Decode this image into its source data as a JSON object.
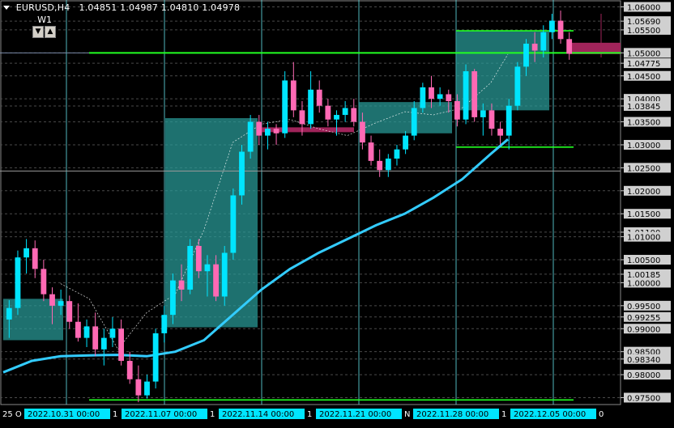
{
  "header": {
    "symbol": "EURUSD,H4",
    "ohlc": "1.04851 1.04987 1.04810 1.04978"
  },
  "overlay_badge": {
    "label": "W1",
    "down_arrow": "▼",
    "up_arrow": "▲"
  },
  "colors": {
    "background": "#000000",
    "grid": "#4a4a4a",
    "bull_candle": "#00e5ff",
    "bear_candle": "#ff69b4",
    "box_fill": "#2a9d9a",
    "green_line": "#22ff22",
    "ma_thick": "#33ccff",
    "ma_thin": "#ffffff",
    "price_label_bg": "#d0d0d0",
    "date_label_bg": "#00e5ff",
    "resistance_bar": "#a0245a"
  },
  "price_axis": {
    "labels": [
      "1.06000",
      "1.05690",
      "1.05500",
      "1.05000",
      "1.04775",
      "1.04500",
      "1.04000",
      "1.03845",
      "1.03500",
      "1.03000",
      "1.02500",
      "1.02000",
      "1.01500",
      "1.01100",
      "1.01000",
      "1.00500",
      "1.00185",
      "1.00000",
      "0.99500",
      "0.99255",
      "0.99000",
      "0.98500",
      "0.98340",
      "0.98000",
      "0.97500"
    ]
  },
  "time_axis": {
    "left_edge_label": "25 O",
    "labels": [
      {
        "text": "2022.10.31 00:00",
        "next": "1"
      },
      {
        "text": "2022.11.07 00:00",
        "next": "1"
      },
      {
        "text": "2022.11.14 00:00",
        "next": "1"
      },
      {
        "text": "2022.11.21 00:00",
        "next": "N"
      },
      {
        "text": "2022.11.28 00:00",
        "next": "1"
      },
      {
        "text": "2022.12.05 00:00",
        "next": "0"
      }
    ]
  },
  "chart_data": {
    "type": "candlestick",
    "symbol": "EURUSD",
    "timeframe": "H4",
    "title": "EURUSD,H4",
    "ohlc_last": {
      "open": 1.04851,
      "high": 1.04987,
      "low": 1.0481,
      "close": 1.04978
    },
    "ylim": [
      0.9735,
      1.0615
    ],
    "grid": true,
    "price_ticks": [
      1.06,
      1.0569,
      1.055,
      1.05,
      1.04775,
      1.045,
      1.04,
      1.03845,
      1.035,
      1.03,
      1.025,
      1.02,
      1.015,
      1.011,
      1.01,
      1.005,
      1.00185,
      1.0,
      0.995,
      0.99255,
      0.99,
      0.985,
      0.9834,
      0.98,
      0.975
    ],
    "week_separators": [
      "2022.10.31 00:00",
      "2022.11.07 00:00",
      "2022.11.14 00:00",
      "2022.11.21 00:00",
      "2022.11.28 00:00",
      "2022.12.05 00:00"
    ],
    "horizontal_levels": [
      {
        "price": 1.05,
        "color": "green"
      },
      {
        "price": 0.9745,
        "color": "green"
      },
      {
        "price": 1.0548,
        "color": "green"
      },
      {
        "price": 1.0295,
        "color": "green"
      }
    ],
    "weekly_boxes": [
      {
        "start": "2022.10.24 00:00",
        "end": "2022.10.31 00:00",
        "high": 0.9965,
        "low": 0.9875
      },
      {
        "start": "2022.11.07 00:00",
        "end": "2022.11.14 00:00",
        "high": 1.0358,
        "low": 0.9903
      },
      {
        "start": "2022.11.21 00:00",
        "end": "2022.11.28 00:00",
        "high": 1.0393,
        "low": 1.0325
      },
      {
        "start": "2022.11.28 00:00",
        "end": "2022.12.05 00:00",
        "high": 1.0548,
        "low": 1.0375
      }
    ],
    "moving_averages": [
      {
        "style": "thick",
        "points": [
          [
            0.0,
            0.9805
          ],
          [
            0.05,
            0.983
          ],
          [
            0.1,
            0.984
          ],
          [
            0.15,
            0.9842
          ],
          [
            0.2,
            0.9843
          ],
          [
            0.25,
            0.984
          ],
          [
            0.3,
            0.985
          ],
          [
            0.35,
            0.9875
          ],
          [
            0.4,
            0.993
          ],
          [
            0.45,
            0.9985
          ],
          [
            0.5,
            1.003
          ],
          [
            0.55,
            1.0065
          ],
          [
            0.6,
            1.0095
          ],
          [
            0.65,
            1.0125
          ],
          [
            0.7,
            1.015
          ],
          [
            0.75,
            1.0185
          ],
          [
            0.8,
            1.0225
          ],
          [
            0.85,
            1.028
          ],
          [
            0.88,
            1.0312
          ]
        ]
      },
      {
        "style": "thin",
        "points": [
          [
            0.1,
            0.9998
          ],
          [
            0.15,
            0.9965
          ],
          [
            0.2,
            0.9855
          ],
          [
            0.25,
            0.9935
          ],
          [
            0.3,
            0.9975
          ],
          [
            0.35,
            1.0115
          ],
          [
            0.4,
            1.0305
          ],
          [
            0.45,
            1.0345
          ],
          [
            0.5,
            1.0355
          ],
          [
            0.55,
            1.0335
          ],
          [
            0.6,
            1.032
          ],
          [
            0.65,
            1.0348
          ],
          [
            0.7,
            1.0372
          ],
          [
            0.75,
            1.0365
          ],
          [
            0.8,
            1.038
          ],
          [
            0.85,
            1.0435
          ],
          [
            0.88,
            1.0497
          ]
        ]
      }
    ],
    "candles": [
      {
        "o": 0.992,
        "h": 0.9962,
        "l": 0.988,
        "c": 0.9945
      },
      {
        "o": 0.9945,
        "h": 1.007,
        "l": 0.993,
        "c": 1.0055
      },
      {
        "o": 1.0055,
        "h": 1.0095,
        "l": 1.002,
        "c": 1.0075
      },
      {
        "o": 1.0075,
        "h": 1.0092,
        "l": 1.001,
        "c": 1.003
      },
      {
        "o": 1.003,
        "h": 1.005,
        "l": 0.996,
        "c": 0.9975
      },
      {
        "o": 0.9975,
        "h": 0.999,
        "l": 0.991,
        "c": 0.995
      },
      {
        "o": 0.995,
        "h": 0.9985,
        "l": 0.993,
        "c": 0.996
      },
      {
        "o": 0.996,
        "h": 0.9972,
        "l": 0.99,
        "c": 0.9915
      },
      {
        "o": 0.9915,
        "h": 0.9955,
        "l": 0.9872,
        "c": 0.988
      },
      {
        "o": 0.988,
        "h": 0.992,
        "l": 0.986,
        "c": 0.9905
      },
      {
        "o": 0.9905,
        "h": 0.9935,
        "l": 0.984,
        "c": 0.9855
      },
      {
        "o": 0.9855,
        "h": 0.99,
        "l": 0.982,
        "c": 0.988
      },
      {
        "o": 0.988,
        "h": 0.9925,
        "l": 0.986,
        "c": 0.99
      },
      {
        "o": 0.99,
        "h": 0.992,
        "l": 0.982,
        "c": 0.983
      },
      {
        "o": 0.983,
        "h": 0.985,
        "l": 0.978,
        "c": 0.979
      },
      {
        "o": 0.979,
        "h": 0.982,
        "l": 0.974,
        "c": 0.9755
      },
      {
        "o": 0.9755,
        "h": 0.98,
        "l": 0.9748,
        "c": 0.9785
      },
      {
        "o": 0.9785,
        "h": 0.99,
        "l": 0.977,
        "c": 0.989
      },
      {
        "o": 0.989,
        "h": 0.995,
        "l": 0.987,
        "c": 0.993
      },
      {
        "o": 0.993,
        "h": 1.002,
        "l": 0.991,
        "c": 1.0005
      },
      {
        "o": 1.0005,
        "h": 1.004,
        "l": 0.996,
        "c": 0.9985
      },
      {
        "o": 0.9985,
        "h": 1.0095,
        "l": 0.9975,
        "c": 1.008
      },
      {
        "o": 1.008,
        "h": 1.0095,
        "l": 1.001,
        "c": 1.0025
      },
      {
        "o": 1.0025,
        "h": 1.006,
        "l": 0.997,
        "c": 1.004
      },
      {
        "o": 1.004,
        "h": 1.006,
        "l": 0.996,
        "c": 0.997
      },
      {
        "o": 0.997,
        "h": 1.008,
        "l": 0.995,
        "c": 1.0065
      },
      {
        "o": 1.0065,
        "h": 1.0205,
        "l": 1.005,
        "c": 1.019
      },
      {
        "o": 1.019,
        "h": 1.03,
        "l": 1.017,
        "c": 1.0285
      },
      {
        "o": 1.0285,
        "h": 1.0365,
        "l": 1.027,
        "c": 1.035
      },
      {
        "o": 1.035,
        "h": 1.0365,
        "l": 1.03,
        "c": 1.032
      },
      {
        "o": 1.032,
        "h": 1.035,
        "l": 1.029,
        "c": 1.0335
      },
      {
        "o": 1.0335,
        "h": 1.0345,
        "l": 1.03,
        "c": 1.0325
      },
      {
        "o": 1.0325,
        "h": 1.046,
        "l": 1.0315,
        "c": 1.044
      },
      {
        "o": 1.044,
        "h": 1.048,
        "l": 1.036,
        "c": 1.0375
      },
      {
        "o": 1.0375,
        "h": 1.0395,
        "l": 1.032,
        "c": 1.0345
      },
      {
        "o": 1.0345,
        "h": 1.046,
        "l": 1.0335,
        "c": 1.042
      },
      {
        "o": 1.042,
        "h": 1.044,
        "l": 1.037,
        "c": 1.0385
      },
      {
        "o": 1.0385,
        "h": 1.04,
        "l": 1.034,
        "c": 1.0355
      },
      {
        "o": 1.0355,
        "h": 1.0375,
        "l": 1.032,
        "c": 1.0365
      },
      {
        "o": 1.0365,
        "h": 1.0395,
        "l": 1.035,
        "c": 1.038
      },
      {
        "o": 1.038,
        "h": 1.04,
        "l": 1.034,
        "c": 1.035
      },
      {
        "o": 1.035,
        "h": 1.037,
        "l": 1.029,
        "c": 1.0305
      },
      {
        "o": 1.0305,
        "h": 1.032,
        "l": 1.0255,
        "c": 1.0265
      },
      {
        "o": 1.0265,
        "h": 1.029,
        "l": 1.023,
        "c": 1.0245
      },
      {
        "o": 1.0245,
        "h": 1.028,
        "l": 1.023,
        "c": 1.027
      },
      {
        "o": 1.027,
        "h": 1.03,
        "l": 1.0255,
        "c": 1.029
      },
      {
        "o": 1.029,
        "h": 1.033,
        "l": 1.028,
        "c": 1.032
      },
      {
        "o": 1.032,
        "h": 1.0395,
        "l": 1.031,
        "c": 1.038
      },
      {
        "o": 1.038,
        "h": 1.0435,
        "l": 1.037,
        "c": 1.0425
      },
      {
        "o": 1.0425,
        "h": 1.045,
        "l": 1.038,
        "c": 1.04
      },
      {
        "o": 1.04,
        "h": 1.0425,
        "l": 1.0385,
        "c": 1.041
      },
      {
        "o": 1.041,
        "h": 1.042,
        "l": 1.037,
        "c": 1.0395
      },
      {
        "o": 1.0395,
        "h": 1.041,
        "l": 1.034,
        "c": 1.0355
      },
      {
        "o": 1.0355,
        "h": 1.0475,
        "l": 1.0345,
        "c": 1.046
      },
      {
        "o": 1.046,
        "h": 1.0465,
        "l": 1.035,
        "c": 1.036
      },
      {
        "o": 1.036,
        "h": 1.039,
        "l": 1.032,
        "c": 1.0375
      },
      {
        "o": 1.0375,
        "h": 1.039,
        "l": 1.032,
        "c": 1.0335
      },
      {
        "o": 1.0335,
        "h": 1.035,
        "l": 1.03,
        "c": 1.032
      },
      {
        "o": 1.032,
        "h": 1.04,
        "l": 1.029,
        "c": 1.0385
      },
      {
        "o": 1.0385,
        "h": 1.048,
        "l": 1.0375,
        "c": 1.047
      },
      {
        "o": 1.047,
        "h": 1.053,
        "l": 1.045,
        "c": 1.052
      },
      {
        "o": 1.052,
        "h": 1.0545,
        "l": 1.048,
        "c": 1.0505
      },
      {
        "o": 1.0505,
        "h": 1.056,
        "l": 1.049,
        "c": 1.0545
      },
      {
        "o": 1.0545,
        "h": 1.0585,
        "l": 1.053,
        "c": 1.057
      },
      {
        "o": 1.057,
        "h": 1.0592,
        "l": 1.052,
        "c": 1.053
      },
      {
        "o": 1.053,
        "h": 1.0545,
        "l": 1.0485,
        "c": 1.0498
      }
    ]
  }
}
